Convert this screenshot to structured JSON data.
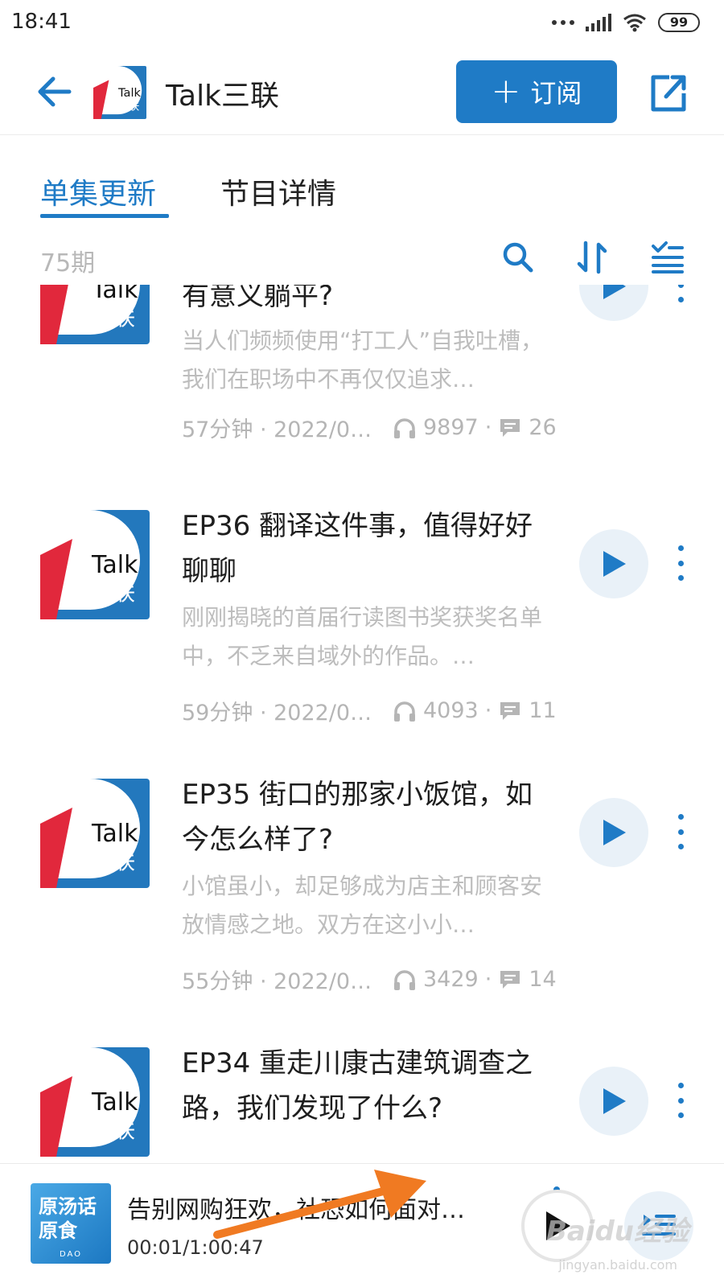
{
  "status_bar": {
    "time": "18:41",
    "battery": "99",
    "icons": [
      "more-dots-icon",
      "signal-icon",
      "wifi-icon",
      "battery-icon"
    ]
  },
  "header": {
    "title": "Talk三联",
    "subscribe_label": "订阅",
    "back_icon": "arrow-left-icon",
    "share_icon": "share-external-icon"
  },
  "tabs": [
    {
      "label": "单集更新",
      "active": true
    },
    {
      "label": "节目详情",
      "active": false
    }
  ],
  "toolbar": {
    "count": "75期",
    "icons": [
      "search-icon",
      "sort-icon",
      "filter-list-icon"
    ]
  },
  "colors": {
    "accent": "#1f7bc6",
    "cover_blue": "#2378bd",
    "cover_red": "#e1283c"
  },
  "episodes": [
    {
      "title": "有意义躺平?",
      "description": "当人们频频使用“打工人”自我吐槽，我们在职场中不再仅仅追求…",
      "duration_date": "57分钟 · 2022/0…",
      "plays": "9897",
      "comments": "26"
    },
    {
      "title": "EP36 翻译这件事，值得好好聊聊",
      "description": "刚刚揭晓的首届行读图书奖获奖名单中，不乏来自域外的作品。…",
      "duration_date": "59分钟 · 2022/0…",
      "plays": "4093",
      "comments": "11"
    },
    {
      "title": "EP35 街口的那家小饭馆，如今怎么样了?",
      "description": "小馆虽小，却足够成为店主和顾客安放情感之地。双方在这小小…",
      "duration_date": "55分钟 · 2022/0…",
      "plays": "3429",
      "comments": "14"
    },
    {
      "title": "EP34 重走川康古建筑调查之路，我们发现了什么?",
      "description": "",
      "duration_date": "",
      "plays": "",
      "comments": ""
    }
  ],
  "cover_logo": {
    "line1": "Talk",
    "line2": "三联"
  },
  "mini_player": {
    "title": "告别网购狂欢，社恐如何面对…",
    "time": "00:01/1:00:47",
    "cover_text": "原汤话原食",
    "cover_sub": "DAO"
  },
  "watermark": {
    "text": "Baidu经验",
    "sub": "jingyan.baidu.com"
  }
}
